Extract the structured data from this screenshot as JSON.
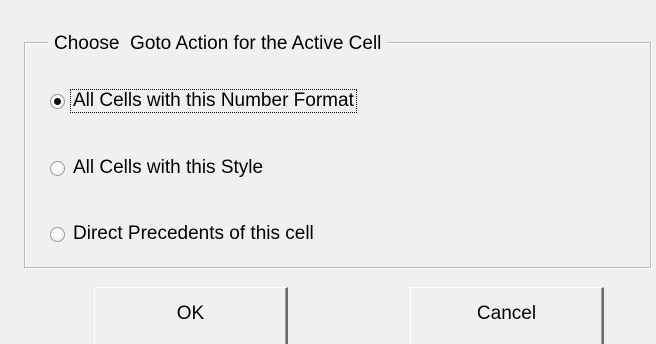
{
  "dialog": {
    "group_title": "Choose  Goto Action for the Active Cell",
    "options": [
      {
        "label": "All Cells with this Number Format",
        "selected": true
      },
      {
        "label": "All Cells with this Style",
        "selected": false
      },
      {
        "label": "Direct Precedents of this cell",
        "selected": false
      }
    ],
    "buttons": {
      "ok_label": "OK",
      "cancel_label": "Cancel"
    }
  }
}
